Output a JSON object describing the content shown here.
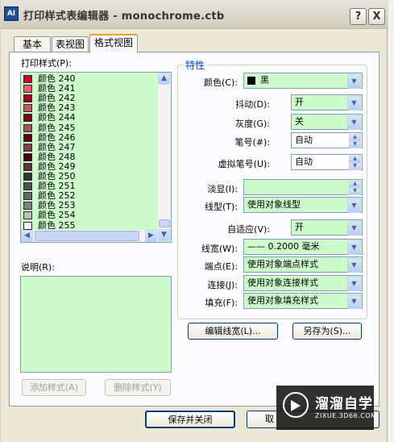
{
  "window": {
    "title": "打印样式表编辑器 - monochrome.ctb",
    "help_button": "?",
    "close_button": "X"
  },
  "tabs": [
    {
      "label": "基本",
      "active": false
    },
    {
      "label": "表视图",
      "active": false
    },
    {
      "label": "格式视图",
      "active": true
    }
  ],
  "styles_list": {
    "label": "打印样式(P):",
    "items": [
      {
        "label": "颜色 240",
        "color": "#cc0033"
      },
      {
        "label": "颜色 241",
        "color": "#e0607d"
      },
      {
        "label": "颜色 242",
        "color": "#a10028"
      },
      {
        "label": "颜色 243",
        "color": "#c95670"
      },
      {
        "label": "颜色 244",
        "color": "#7a001e"
      },
      {
        "label": "颜色 245",
        "color": "#a35564"
      },
      {
        "label": "颜色 246",
        "color": "#5e0016"
      },
      {
        "label": "颜色 247",
        "color": "#7a4050"
      },
      {
        "label": "颜色 248",
        "color": "#47000f"
      },
      {
        "label": "颜色 249",
        "color": "#5c3540"
      },
      {
        "label": "颜色 250",
        "color": "#333333"
      },
      {
        "label": "颜色 251",
        "color": "#505050"
      },
      {
        "label": "颜色 252",
        "color": "#696969"
      },
      {
        "label": "颜色 253",
        "color": "#828282"
      },
      {
        "label": "颜色 254",
        "color": "#bebebe"
      },
      {
        "label": "颜色 255",
        "color": "#ffffff"
      }
    ]
  },
  "description": {
    "label": "说明(R):",
    "value": ""
  },
  "buttons": {
    "add_style": "添加样式(A)",
    "delete_style": "删除样式(Y)",
    "edit_lineweights": "编辑线宽(L)...",
    "save_as": "另存为(S)...",
    "save_close": "保存并关闭",
    "cancel_partial": "取"
  },
  "properties": {
    "group_title": "特性",
    "color": {
      "label": "颜色(C):",
      "value": "黑",
      "swatch": "#000000"
    },
    "dither": {
      "label": "抖动(D):",
      "value": "开"
    },
    "grayscale": {
      "label": "灰度(G):",
      "value": "关"
    },
    "pen": {
      "label": "笔号(#):",
      "value": "自动"
    },
    "virtual_pen": {
      "label": "虚拟笔号(U):",
      "value": "自动"
    },
    "screening": {
      "label": "淡显(I):",
      "value": ""
    },
    "linetype": {
      "label": "线型(T):",
      "value": "使用对象线型"
    },
    "adaptive": {
      "label": "自适应(V):",
      "value": "开"
    },
    "lineweight": {
      "label": "线宽(W):",
      "value": "—— 0.2000 毫米"
    },
    "line_end": {
      "label": "端点(E):",
      "value": "使用对象端点样式"
    },
    "line_join": {
      "label": "连接(J):",
      "value": "使用对象连接样式"
    },
    "fill": {
      "label": "填充(F):",
      "value": "使用对象填充样式"
    }
  },
  "watermark": {
    "name": "溜溜自学",
    "url": "ZIXUE.3D66.COM"
  }
}
